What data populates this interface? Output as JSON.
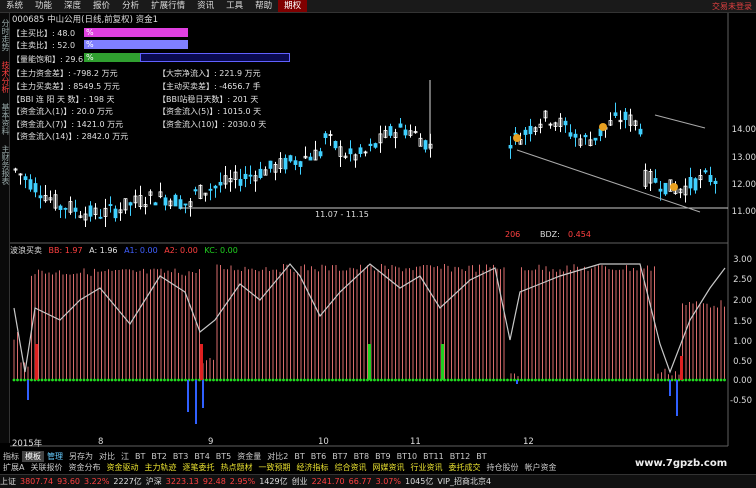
{
  "menu": {
    "items": [
      "系统",
      "功能",
      "深度",
      "报价",
      "分析",
      "扩展行情",
      "资讯",
      "工具",
      "帮助"
    ],
    "active": "期权",
    "right": "交易未登录"
  },
  "sidebar": [
    "分时走势",
    "技术分析",
    "基本资料",
    "主财务报表"
  ],
  "header": {
    "title": "000685 中山公用(日线,前复权) 资金1"
  },
  "info": {
    "buy_ratio_label": "【主买比】: 48.0",
    "buy_ratio_pct": "%",
    "sell_ratio_label": "【主卖比】: 52.0",
    "sell_ratio_pct": "%",
    "volume_label": "【量能饱和】: 29.6",
    "volume_pct": "%",
    "main_net": "【主力资金差】: -798.2 万元",
    "large_net": "【大宗净流入】: 221.9 万元",
    "main_buy": "【主力买卖差】: 8549.5 万元",
    "active_buy": "【主动买卖差】: -4656.7 手",
    "bbi": "【BBI 连 阳 天 数】: 198 天",
    "bbi_rt": "【BBI站稳日天数】: 201 天",
    "inflow1": "【资金流入(1)】: 20.0 万元",
    "inflow5": "【资金流入(5)】: 1015.0 天",
    "inflow7": "【资金流入(7)】: 1421.0 万元",
    "inflow10": "【资金流入(10)】: 2030.0 天",
    "inflow14": "【资金流入(14)】: 2842.0 万元"
  },
  "price_axis": [
    "14.00",
    "13.00",
    "12.00",
    "11.00"
  ],
  "range_label": "11.07 - 11.15",
  "bdz": {
    "left": "206",
    "label": "BDZ:",
    "value": "0.454"
  },
  "legend": {
    "name": "波浪买卖",
    "bb": "BB: 1.97",
    "a": "A: 1.96",
    "a1": "A1: 0.00",
    "a2": "A2: 0.00",
    "kc": "KC: 0.00"
  },
  "ind_axis": [
    "3.00",
    "2.50",
    "2.00",
    "1.50",
    "1.00",
    "0.50",
    "0.00",
    "-0.50"
  ],
  "xaxis": [
    "2015年",
    "8",
    "9",
    "10",
    "11",
    "12"
  ],
  "tabs1": [
    "指标",
    "模板",
    "管理",
    "另存为",
    "对比",
    "江",
    "BT",
    "BT2",
    "BT3",
    "BT4",
    "BT5",
    "资金量",
    "对比2",
    "BT",
    "BT6",
    "BT7",
    "BT8",
    "BT9",
    "BT10",
    "BT11",
    "BT12",
    "BT"
  ],
  "tabs2": [
    "扩展A",
    "关联报价",
    "资金分布",
    "资金驱动",
    "主力轨迹",
    "逐笔委托",
    "热点题材",
    "一致预期",
    "经济指标",
    "综合资讯",
    "网媒资讯",
    "行业资讯",
    "委托成交",
    "持仓股份",
    "帐户资金"
  ],
  "tabs2_highlight": [
    3,
    4,
    5,
    6,
    7,
    8,
    9,
    10,
    11,
    12
  ],
  "watermark": "www.7gpzb.com",
  "status": {
    "sh_label": "上证",
    "sh_val": "3807.74",
    "sh_chg": "93.60",
    "sh_pct": "3.22%",
    "sh_amt": "2227亿",
    "hs_label": "沪深",
    "hs_val": "3223.13",
    "hs_chg": "92.48",
    "hs_pct": "2.95%",
    "hs_amt": "1429亿",
    "cy_label": "创业",
    "cy_val": "2241.70",
    "cy_chg": "66.77",
    "cy_pct": "3.07%",
    "cy_amt": "1045亿",
    "vip": "VIP_招商北京4"
  },
  "colors": {
    "up": "#ff4040",
    "down": "#40d0ff",
    "green": "#20d020",
    "blue": "#3060ff",
    "pink": "#ff80c0"
  }
}
